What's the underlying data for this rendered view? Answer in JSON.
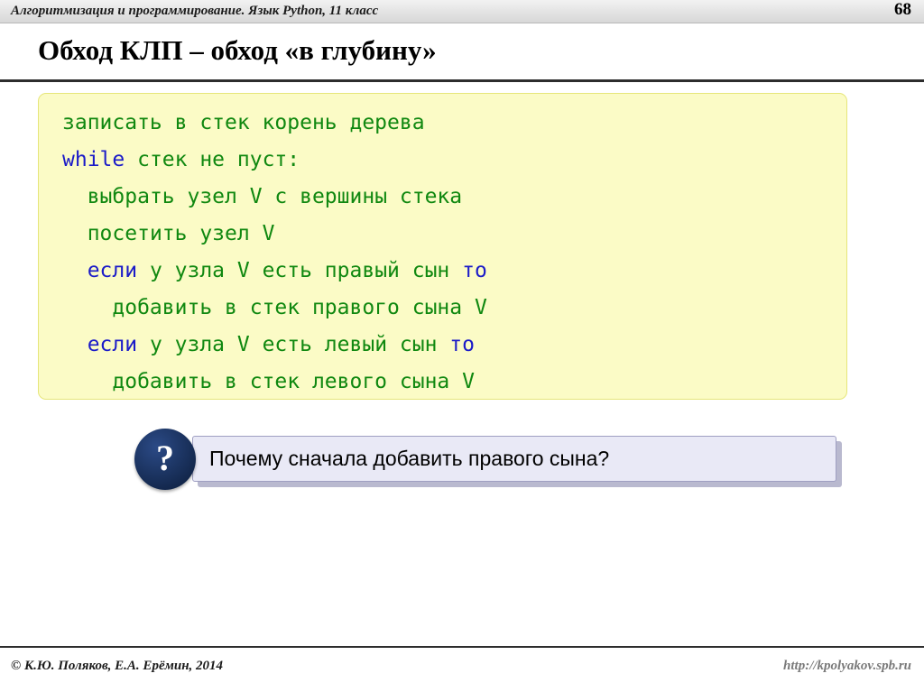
{
  "header": {
    "title": "Алгоритмизация и программирование. Язык Python, 11 класс",
    "slide_number": "68"
  },
  "slide": {
    "title": "Обход КЛП – обход «в глубину»"
  },
  "code": {
    "lines": [
      {
        "indent": 0,
        "segments": [
          {
            "text": "записать в стек корень дерева",
            "color": "green"
          }
        ]
      },
      {
        "indent": 0,
        "segments": [
          {
            "text": "while",
            "color": "blue"
          },
          {
            "text": " стек не пуст:",
            "color": "green"
          }
        ]
      },
      {
        "indent": 2,
        "segments": [
          {
            "text": "выбрать узел V с вершины стека",
            "color": "green"
          }
        ]
      },
      {
        "indent": 2,
        "segments": [
          {
            "text": "посетить узел V",
            "color": "green"
          }
        ]
      },
      {
        "indent": 2,
        "segments": [
          {
            "text": "если",
            "color": "blue"
          },
          {
            "text": " у узла V есть правый сын ",
            "color": "green"
          },
          {
            "text": "то",
            "color": "blue"
          }
        ]
      },
      {
        "indent": 4,
        "segments": [
          {
            "text": "добавить в стек правого сына V",
            "color": "green"
          }
        ]
      },
      {
        "indent": 2,
        "segments": [
          {
            "text": "если",
            "color": "blue"
          },
          {
            "text": " у узла V есть левый сын ",
            "color": "green"
          },
          {
            "text": "то",
            "color": "blue"
          }
        ]
      },
      {
        "indent": 4,
        "segments": [
          {
            "text": "добавить в стек левого сына V",
            "color": "green"
          }
        ]
      }
    ]
  },
  "callout": {
    "icon": "question-mark",
    "icon_glyph": "?",
    "text": "Почему сначала добавить правого сына?"
  },
  "footer": {
    "copyright": "© К.Ю. Поляков, Е.А. Ерёмин, 2014",
    "url": "http://kpolyakov.spb.ru"
  },
  "colors": {
    "code_background": "#fbfbc6",
    "code_green": "#108810",
    "code_blue": "#1b1bc8",
    "callout_background": "#e9e9f6",
    "icon_background": "#1f3864"
  }
}
